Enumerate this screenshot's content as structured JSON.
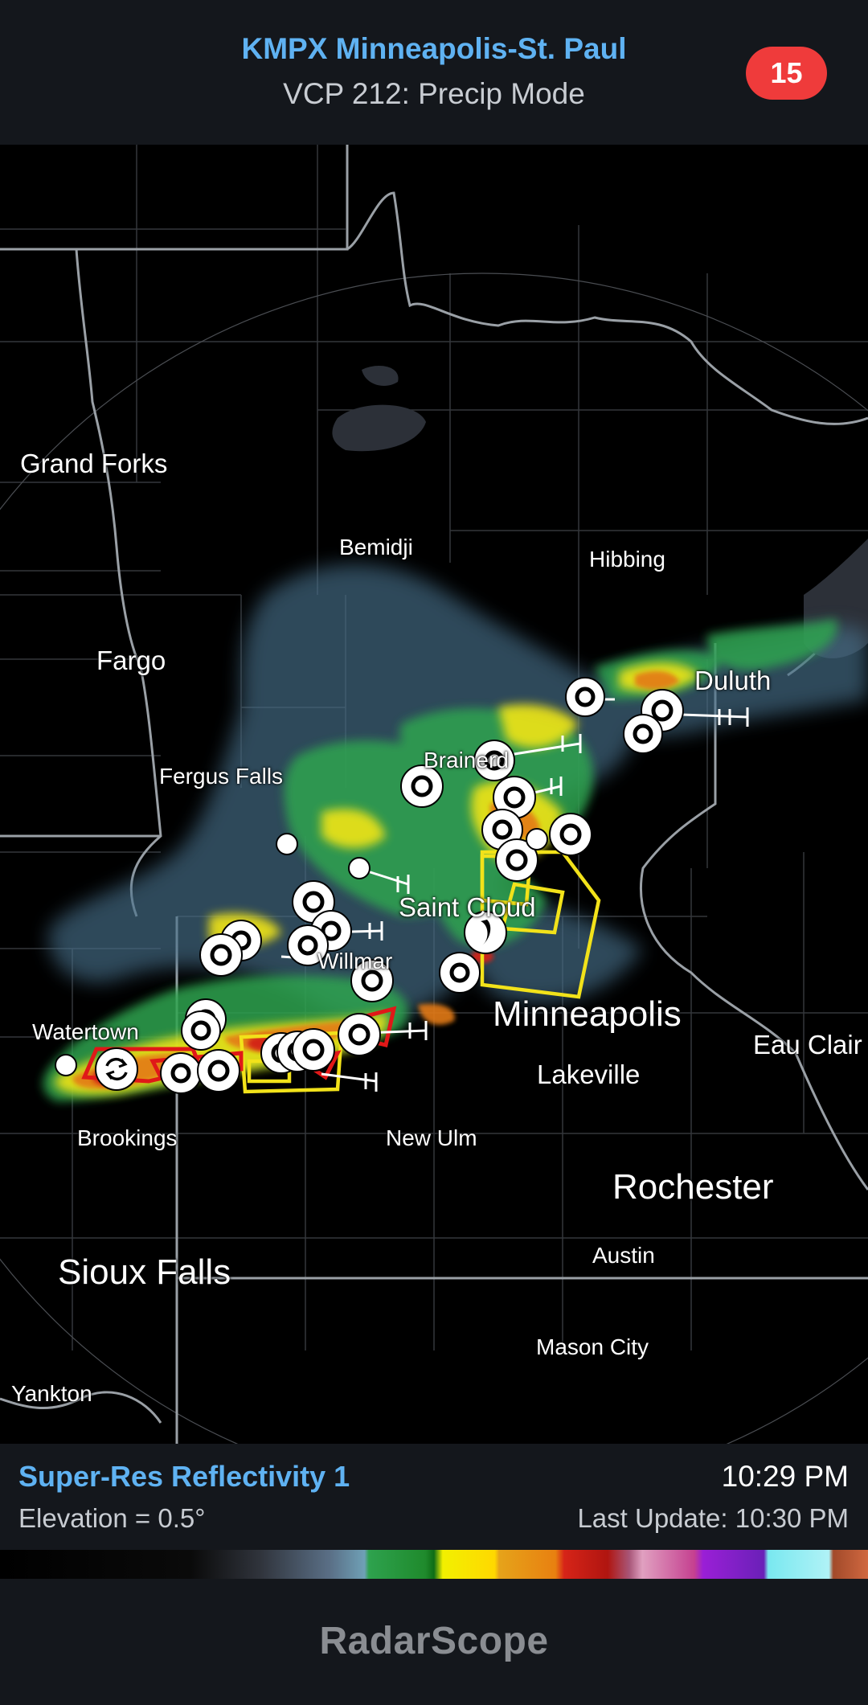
{
  "header": {
    "station": "KMPX Minneapolis-St. Paul",
    "mode": "VCP 212: Precip Mode",
    "alert_count": "15"
  },
  "map": {
    "cities": [
      {
        "name": "Grand Forks",
        "size": "md"
      },
      {
        "name": "Bemidji",
        "size": "sm"
      },
      {
        "name": "Hibbing",
        "size": "sm"
      },
      {
        "name": "Fargo",
        "size": "md"
      },
      {
        "name": "Duluth",
        "size": "md"
      },
      {
        "name": "Brainerd",
        "size": "sm"
      },
      {
        "name": "Fergus Falls",
        "size": "sm"
      },
      {
        "name": "Saint Cloud",
        "size": "md"
      },
      {
        "name": "Willmar",
        "size": "sm"
      },
      {
        "name": "Minneapolis",
        "size": "lg"
      },
      {
        "name": "Watertown",
        "size": "sm"
      },
      {
        "name": "Eau Clair",
        "size": "md"
      },
      {
        "name": "Lakeville",
        "size": "md"
      },
      {
        "name": "Brookings",
        "size": "sm"
      },
      {
        "name": "New Ulm",
        "size": "sm"
      },
      {
        "name": "Rochester",
        "size": "lg"
      },
      {
        "name": "Austin",
        "size": "sm"
      },
      {
        "name": "Sioux Falls",
        "size": "lg"
      },
      {
        "name": "Mason City",
        "size": "sm"
      },
      {
        "name": "Yankton",
        "size": "sm"
      }
    ],
    "warning_colors": {
      "tornado": "#e01818",
      "severe_thunderstorm": "#f2e21a"
    }
  },
  "info": {
    "product": "Super-Res Reflectivity 1",
    "elevation": "Elevation = 0.5°",
    "time": "10:29 PM",
    "last_update": "Last Update: 10:30 PM"
  },
  "footer": {
    "app_name": "RadarScope"
  },
  "colors": {
    "accent": "#5fb2f2",
    "badge": "#ef3b3b",
    "panel": "#14171c"
  }
}
